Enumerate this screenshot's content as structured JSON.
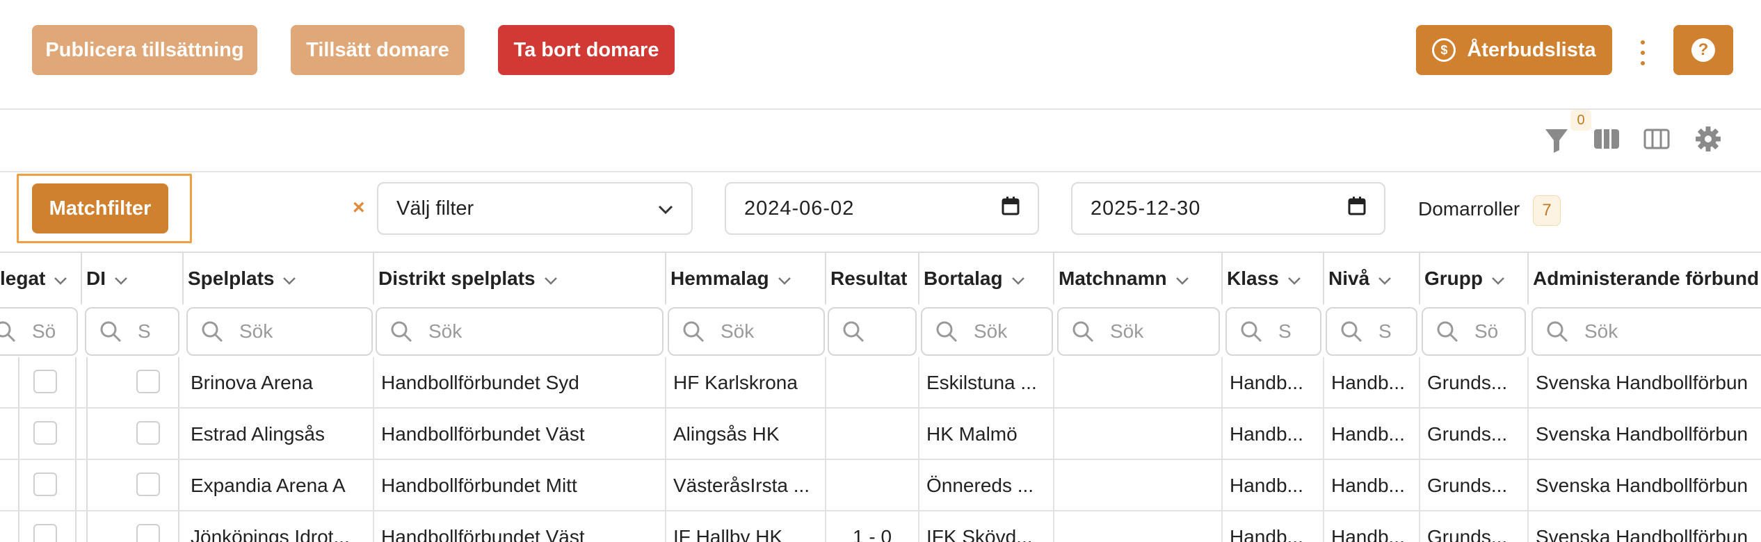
{
  "actions": {
    "publish": "Publicera tillsättning",
    "assign": "Tillsätt domare",
    "remove": "Ta bort domare",
    "cancellation_list": "Återbudslista",
    "help": "?"
  },
  "toolbar": {
    "filter_count": "0"
  },
  "filters": {
    "matchfilter": "Matchfilter",
    "clear": "×",
    "select_placeholder": "Välj filter",
    "date_from": "2024-06-02",
    "date_to": "2025-12-30",
    "referee_roles_label": "Domarroller",
    "referee_roles_count": "7"
  },
  "grid": {
    "columns": [
      {
        "label": "legat",
        "search": "Sö"
      },
      {
        "label": "DI",
        "search": "S"
      },
      {
        "label": "Spelplats",
        "search": "Sök"
      },
      {
        "label": "Distrikt spelplats",
        "search": "Sök"
      },
      {
        "label": "Hemmalag",
        "search": "Sök"
      },
      {
        "label": "Resultat",
        "search": ""
      },
      {
        "label": "Bortalag",
        "search": "Sök"
      },
      {
        "label": "Matchnamn",
        "search": "Sök"
      },
      {
        "label": "Klass",
        "search": "S"
      },
      {
        "label": "Nivå",
        "search": "S"
      },
      {
        "label": "Grupp",
        "search": "Sö"
      },
      {
        "label": "Administerande förbund",
        "search": "Sök"
      }
    ],
    "rows": [
      {
        "spelplats": "Brinova Arena",
        "distrikt": "Handbollförbundet Syd",
        "hemmalag": "HF Karlskrona",
        "resultat": "",
        "bortalag": "Eskilstuna ...",
        "matchnamn": "",
        "klass": "Handb...",
        "niva": "Handb...",
        "grupp": "Grunds...",
        "forbund": "Svenska Handbollförbun"
      },
      {
        "spelplats": "Estrad Alingsås",
        "distrikt": "Handbollförbundet Väst",
        "hemmalag": "Alingsås HK",
        "resultat": "",
        "bortalag": "HK Malmö",
        "matchnamn": "",
        "klass": "Handb...",
        "niva": "Handb...",
        "grupp": "Grunds...",
        "forbund": "Svenska Handbollförbun"
      },
      {
        "spelplats": "Expandia Arena A",
        "distrikt": "Handbollförbundet Mitt",
        "hemmalag": "VästeråsIrsta ...",
        "resultat": "",
        "bortalag": "Önnereds ...",
        "matchnamn": "",
        "klass": "Handb...",
        "niva": "Handb...",
        "grupp": "Grunds...",
        "forbund": "Svenska Handbollförbun"
      },
      {
        "spelplats": "Jönköpings Idrot...",
        "distrikt": "Handbollförbundet Väst",
        "hemmalag": "IF Hallby HK",
        "resultat": "1 - 0",
        "bortalag": "IFK Skövd...",
        "matchnamn": "",
        "klass": "Handb...",
        "niva": "Handb...",
        "grupp": "Grunds...",
        "forbund": "Svenska Handbollförbun"
      }
    ]
  },
  "colors": {
    "primary": "#d08130",
    "primary_light": "#e0a878",
    "danger": "#d13a34",
    "focus_outline": "#f0a040"
  }
}
